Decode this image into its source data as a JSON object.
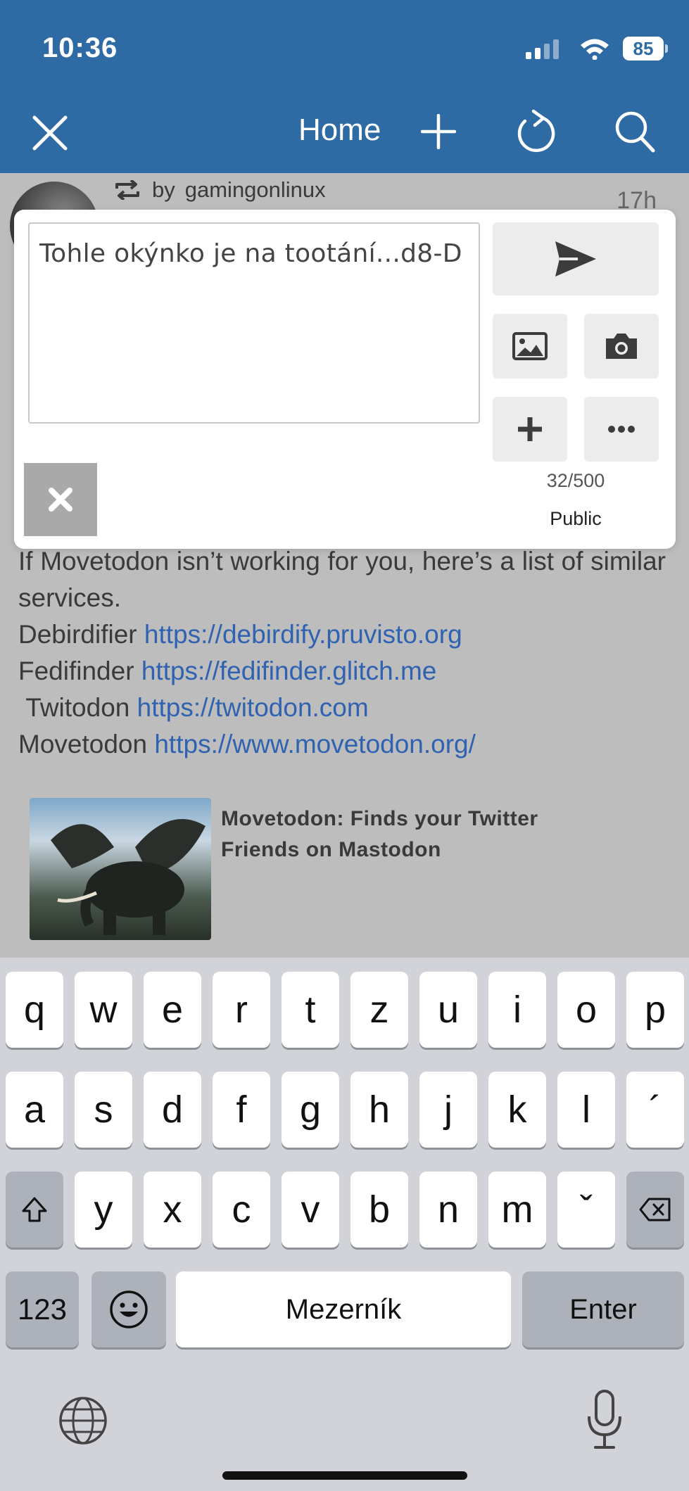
{
  "status_bar": {
    "time": "10:36",
    "battery": "85"
  },
  "nav": {
    "title": "Home"
  },
  "feed": {
    "boost_prefix": "by",
    "boost_user": "gamingonlinux",
    "time": "17h",
    "lines": {
      "intro": "If Movetodon isn’t working for you, here’s a list of similar services.",
      "l1_name": "Debirdifier",
      "l1_url": "https://debirdify.pruvisto.org",
      "l2_name": "Fedifinder",
      "l2_url": "https://fedifinder.glitch.me",
      "l3_name": "Twitodon",
      "l3_url": "https://twitodon.com",
      "l4_name": "Movetodon",
      "l4_url": "https://www.movetodon.org/"
    },
    "card_title": "Movetodon: Finds your Twitter Friends on Mastodon"
  },
  "compose": {
    "text": "Tohle okýnko je na tootání...d8-D",
    "counter": "32/500",
    "visibility": "Public"
  },
  "keyboard": {
    "row1": [
      "q",
      "w",
      "e",
      "r",
      "t",
      "z",
      "u",
      "i",
      "o",
      "p"
    ],
    "row2": [
      "a",
      "s",
      "d",
      "f",
      "g",
      "h",
      "j",
      "k",
      "l",
      "´"
    ],
    "row3": [
      "y",
      "x",
      "c",
      "v",
      "b",
      "n",
      "m",
      "ˇ"
    ],
    "numbers": "123",
    "space": "Mezerník",
    "enter": "Enter"
  }
}
